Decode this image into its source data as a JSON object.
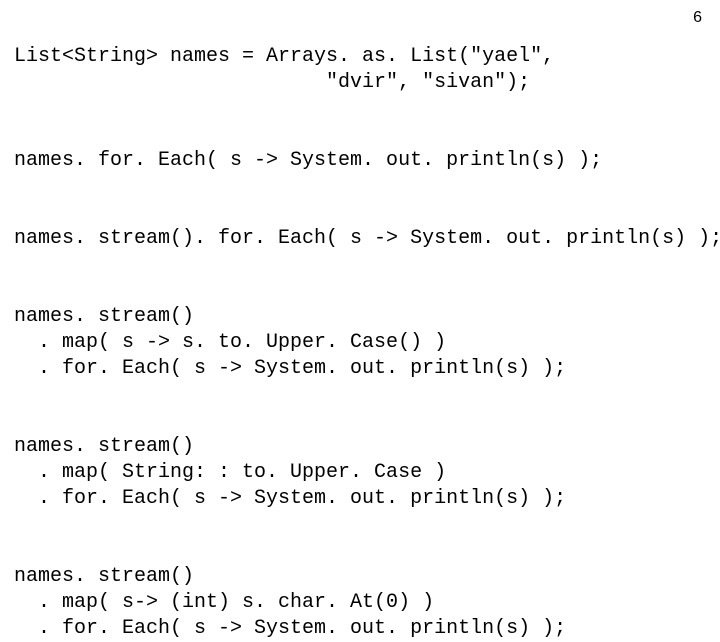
{
  "page_number": "6",
  "blocks": {
    "b1_line1": "List<String> names = Arrays. as. List(\"yael\",",
    "b1_line2": "                          \"dvir\", \"sivan\");",
    "b2_line1": "names. for. Each( s -> System. out. println(s) );",
    "b3_line1": "names. stream(). for. Each( s -> System. out. println(s) );",
    "b4_line1": "names. stream()",
    "b4_line2": "  . map( s -> s. to. Upper. Case() )",
    "b4_line3": "  . for. Each( s -> System. out. println(s) );",
    "b5_line1": "names. stream()",
    "b5_line2": "  . map( String: : to. Upper. Case )",
    "b5_line3": "  . for. Each( s -> System. out. println(s) );",
    "b6_line1": "names. stream()",
    "b6_line2": "  . map( s-> (int) s. char. At(0) )",
    "b6_line3": "  . for. Each( s -> System. out. println(s) );"
  }
}
